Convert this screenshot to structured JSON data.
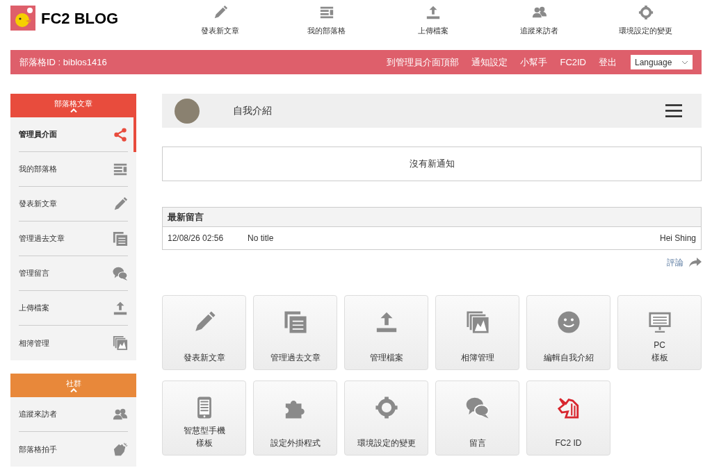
{
  "logo": {
    "text": "FC2 BLOG"
  },
  "top_nav": [
    {
      "label": "發表新文章"
    },
    {
      "label": "我的部落格"
    },
    {
      "label": "上傳檔案"
    },
    {
      "label": "追蹤來訪者"
    },
    {
      "label": "環境設定的變更"
    }
  ],
  "admin_bar": {
    "blog_id": "部落格ID : biblos1416",
    "links": [
      "到管理員介面頂部",
      "通知設定",
      "小幫手",
      "FC2ID",
      "登出"
    ],
    "language": {
      "value": "Language"
    }
  },
  "sidebar": [
    {
      "title": "部落格文章",
      "color": "#e84c3d",
      "expanded": true,
      "items": [
        {
          "label": "管理員介面",
          "selected": true
        },
        {
          "label": "我的部落格",
          "selected": false
        },
        {
          "label": "發表新文章",
          "selected": false
        },
        {
          "label": "管理過去文章",
          "selected": false
        },
        {
          "label": "管理留言",
          "selected": false
        },
        {
          "label": "上傳檔案",
          "selected": false
        },
        {
          "label": "相簿管理",
          "selected": false
        }
      ]
    },
    {
      "title": "社群",
      "color": "#e8883a",
      "expanded": true,
      "items": [
        {
          "label": "追蹤來訪者",
          "selected": false
        },
        {
          "label": "部落格拍手",
          "selected": false
        }
      ]
    }
  ],
  "profile": {
    "title": "自我介紹"
  },
  "notification": "沒有新通知",
  "latest_comments": {
    "title": "最新留言",
    "rows": [
      {
        "date": "12/08/26 02:56",
        "title": "No title",
        "author": "Hei Shing"
      }
    ],
    "more_link": "評論"
  },
  "tiles": [
    {
      "lines": [
        "發表新文章"
      ]
    },
    {
      "lines": [
        "管理過去文章"
      ]
    },
    {
      "lines": [
        "管理檔案"
      ]
    },
    {
      "lines": [
        "相簿管理"
      ]
    },
    {
      "lines": [
        "編輯自我介紹"
      ]
    },
    {
      "lines": [
        "PC",
        "樣板"
      ]
    },
    {
      "lines": [
        "智慧型手機",
        "樣板"
      ]
    },
    {
      "lines": [
        "設定外掛程式"
      ]
    },
    {
      "lines": [
        "環境設定的變更"
      ]
    },
    {
      "lines": [
        "留言"
      ]
    },
    {
      "lines": [
        "FC2 ID"
      ]
    }
  ]
}
